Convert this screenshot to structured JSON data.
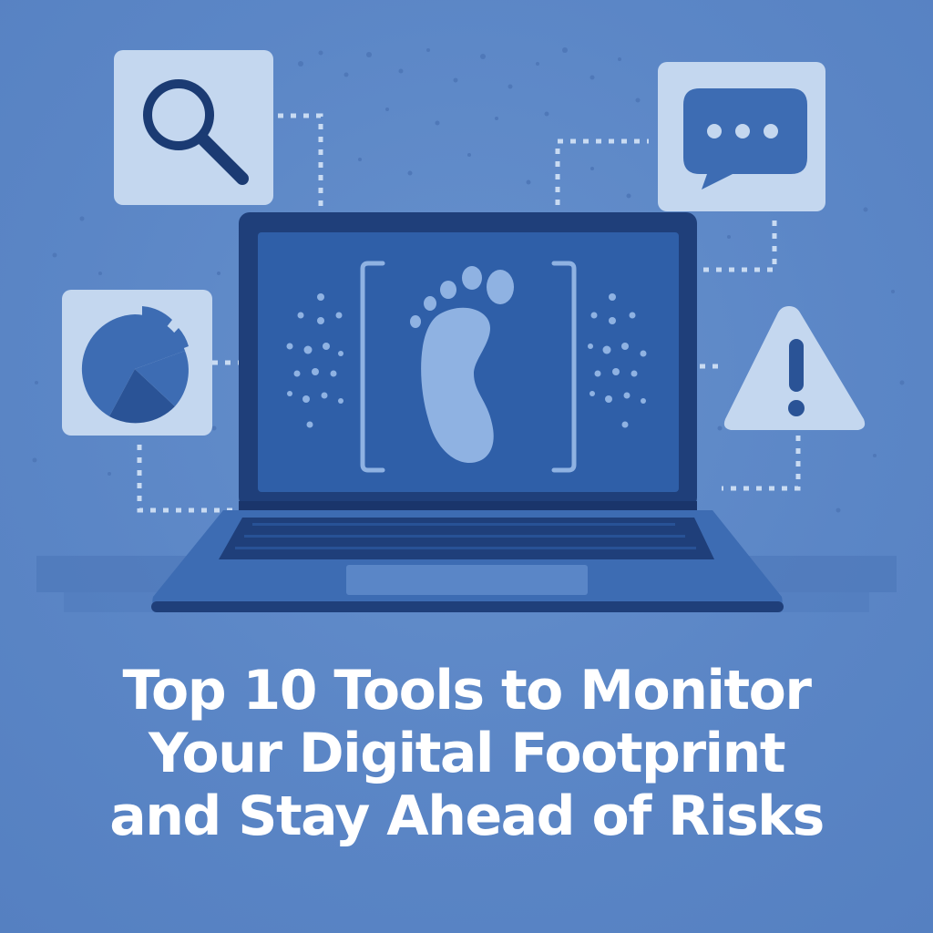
{
  "headline": {
    "line1": "Top 10 Tools to Monitor",
    "line2": "Your Digital Footprint",
    "line3": "and Stay Ahead of Risks"
  },
  "icons": {
    "top_left": "search-icon",
    "top_right": "chat-bubble-icon",
    "middle_left": "pie-chart-icon",
    "middle_right": "warning-icon",
    "screen": "footprint-icon"
  },
  "colors": {
    "background": "#5b86c6",
    "laptop_frame": "#1f3f7a",
    "screen": "#2f5fa8",
    "icon_tile": "#c4d7ef",
    "accent_light": "#8fb2e2",
    "text": "#ffffff"
  }
}
